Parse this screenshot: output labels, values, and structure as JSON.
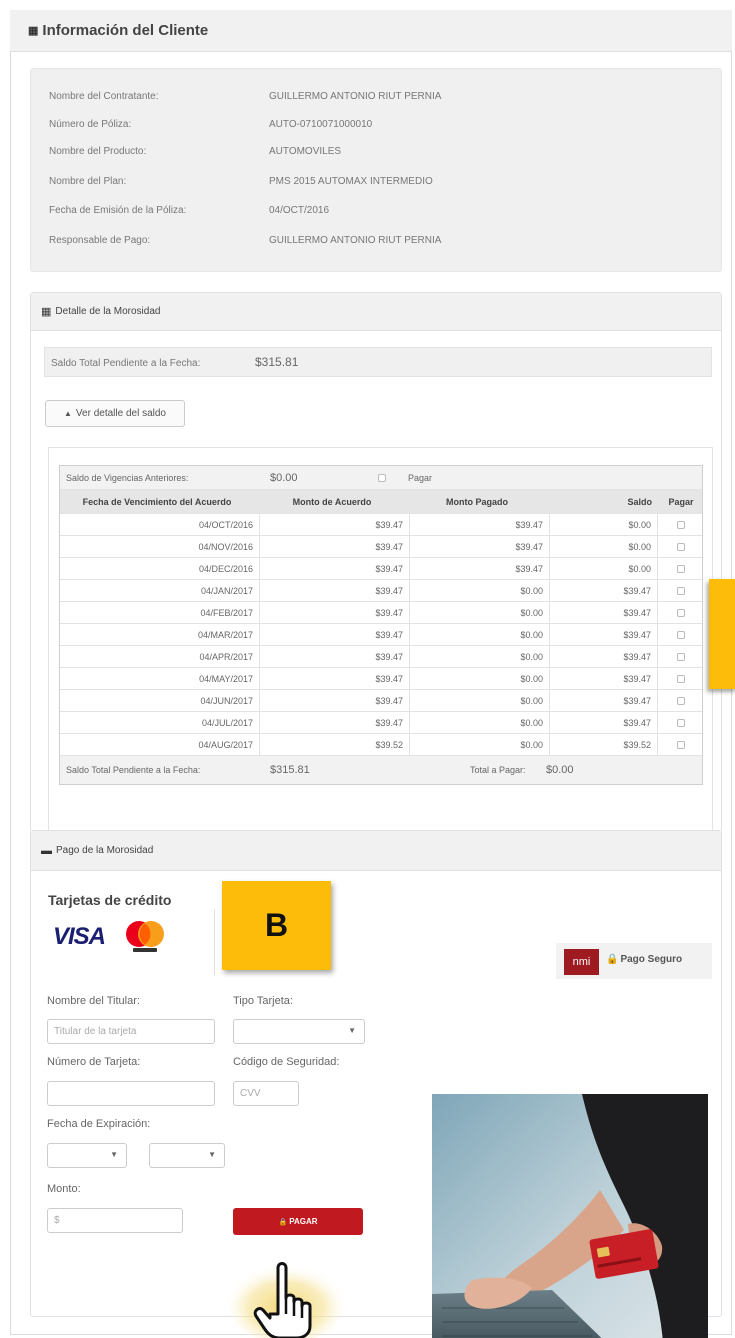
{
  "sections": {
    "info": {
      "title": "Información del Cliente",
      "rows": [
        {
          "label": "Nombre del Contratante:",
          "value": "GUILLERMO ANTONIO RIUT PERNIA"
        },
        {
          "label": "Número de Póliza:",
          "value": "AUTO-0710071000010"
        },
        {
          "label": "Nombre del Producto:",
          "value": "AUTOMOVILES"
        },
        {
          "label": "Nombre del Plan:",
          "value": "PMS 2015 AUTOMAX INTERMEDIO"
        },
        {
          "label": "Fecha de Emisión de la Póliza:",
          "value": "04/OCT/2016"
        },
        {
          "label": "Responsable de Pago:",
          "value": "GUILLERMO ANTONIO RIUT PERNIA"
        }
      ]
    },
    "morosidad": {
      "title": "Detalle de la Morosidad",
      "saldo_label": "Saldo Total Pendiente a la Fecha:",
      "saldo_value": "$315.81",
      "toggle_label": "Ver detalle del saldo",
      "table": {
        "top": {
          "label": "Saldo de Vigencias Anteriores:",
          "value": "$0.00",
          "pay_label": "Pagar"
        },
        "headers": [
          "Fecha de Vencimiento del Acuerdo",
          "Monto de Acuerdo",
          "Monto Pagado",
          "Saldo",
          "Pagar"
        ],
        "rows": [
          {
            "fecha": "04/OCT/2016",
            "monto": "$39.47",
            "pagado": "$39.47",
            "saldo": "$0.00"
          },
          {
            "fecha": "04/NOV/2016",
            "monto": "$39.47",
            "pagado": "$39.47",
            "saldo": "$0.00"
          },
          {
            "fecha": "04/DEC/2016",
            "monto": "$39.47",
            "pagado": "$39.47",
            "saldo": "$0.00"
          },
          {
            "fecha": "04/JAN/2017",
            "monto": "$39.47",
            "pagado": "$0.00",
            "saldo": "$39.47"
          },
          {
            "fecha": "04/FEB/2017",
            "monto": "$39.47",
            "pagado": "$0.00",
            "saldo": "$39.47"
          },
          {
            "fecha": "04/MAR/2017",
            "monto": "$39.47",
            "pagado": "$0.00",
            "saldo": "$39.47"
          },
          {
            "fecha": "04/APR/2017",
            "monto": "$39.47",
            "pagado": "$0.00",
            "saldo": "$39.47"
          },
          {
            "fecha": "04/MAY/2017",
            "monto": "$39.47",
            "pagado": "$0.00",
            "saldo": "$39.47"
          },
          {
            "fecha": "04/JUN/2017",
            "monto": "$39.47",
            "pagado": "$0.00",
            "saldo": "$39.47"
          },
          {
            "fecha": "04/JUL/2017",
            "monto": "$39.47",
            "pagado": "$0.00",
            "saldo": "$39.47"
          },
          {
            "fecha": "04/AUG/2017",
            "monto": "$39.52",
            "pagado": "$0.00",
            "saldo": "$39.52"
          }
        ],
        "footer": {
          "label": "Saldo Total Pendiente a la Fecha:",
          "value": "$315.81",
          "total_label": "Total a Pagar:",
          "total_value": "$0.00"
        }
      }
    },
    "pago": {
      "title": "Pago de la Morosidad",
      "cards_title": "Tarjetas de crédito",
      "visa_text": "VISA",
      "nmi_text": "nmi",
      "secure_text": "Pago Seguro",
      "form": {
        "holder_label": "Nombre del Titular:",
        "holder_placeholder": "Titular de la tarjeta",
        "type_label": "Tipo Tarjeta:",
        "number_label": "Número de Tarjeta:",
        "cvv_label": "Código de Seguridad:",
        "cvv_placeholder": "CVV",
        "expiry_label": "Fecha de Expiración:",
        "amount_label": "Monto:",
        "amount_value": "$",
        "pay_button": "PAGAR"
      }
    }
  },
  "callouts": {
    "b": "B"
  },
  "icons": {
    "section": "th-icon",
    "toggle": "chevron-up-icon",
    "lock": "lock-icon",
    "hand": "hand-pointer-icon"
  },
  "colors": {
    "accent_yellow": "#fcbc09",
    "pay_button": "#c0191f",
    "visa_blue": "#1a1f71",
    "nmi_red": "#9e1b22"
  }
}
